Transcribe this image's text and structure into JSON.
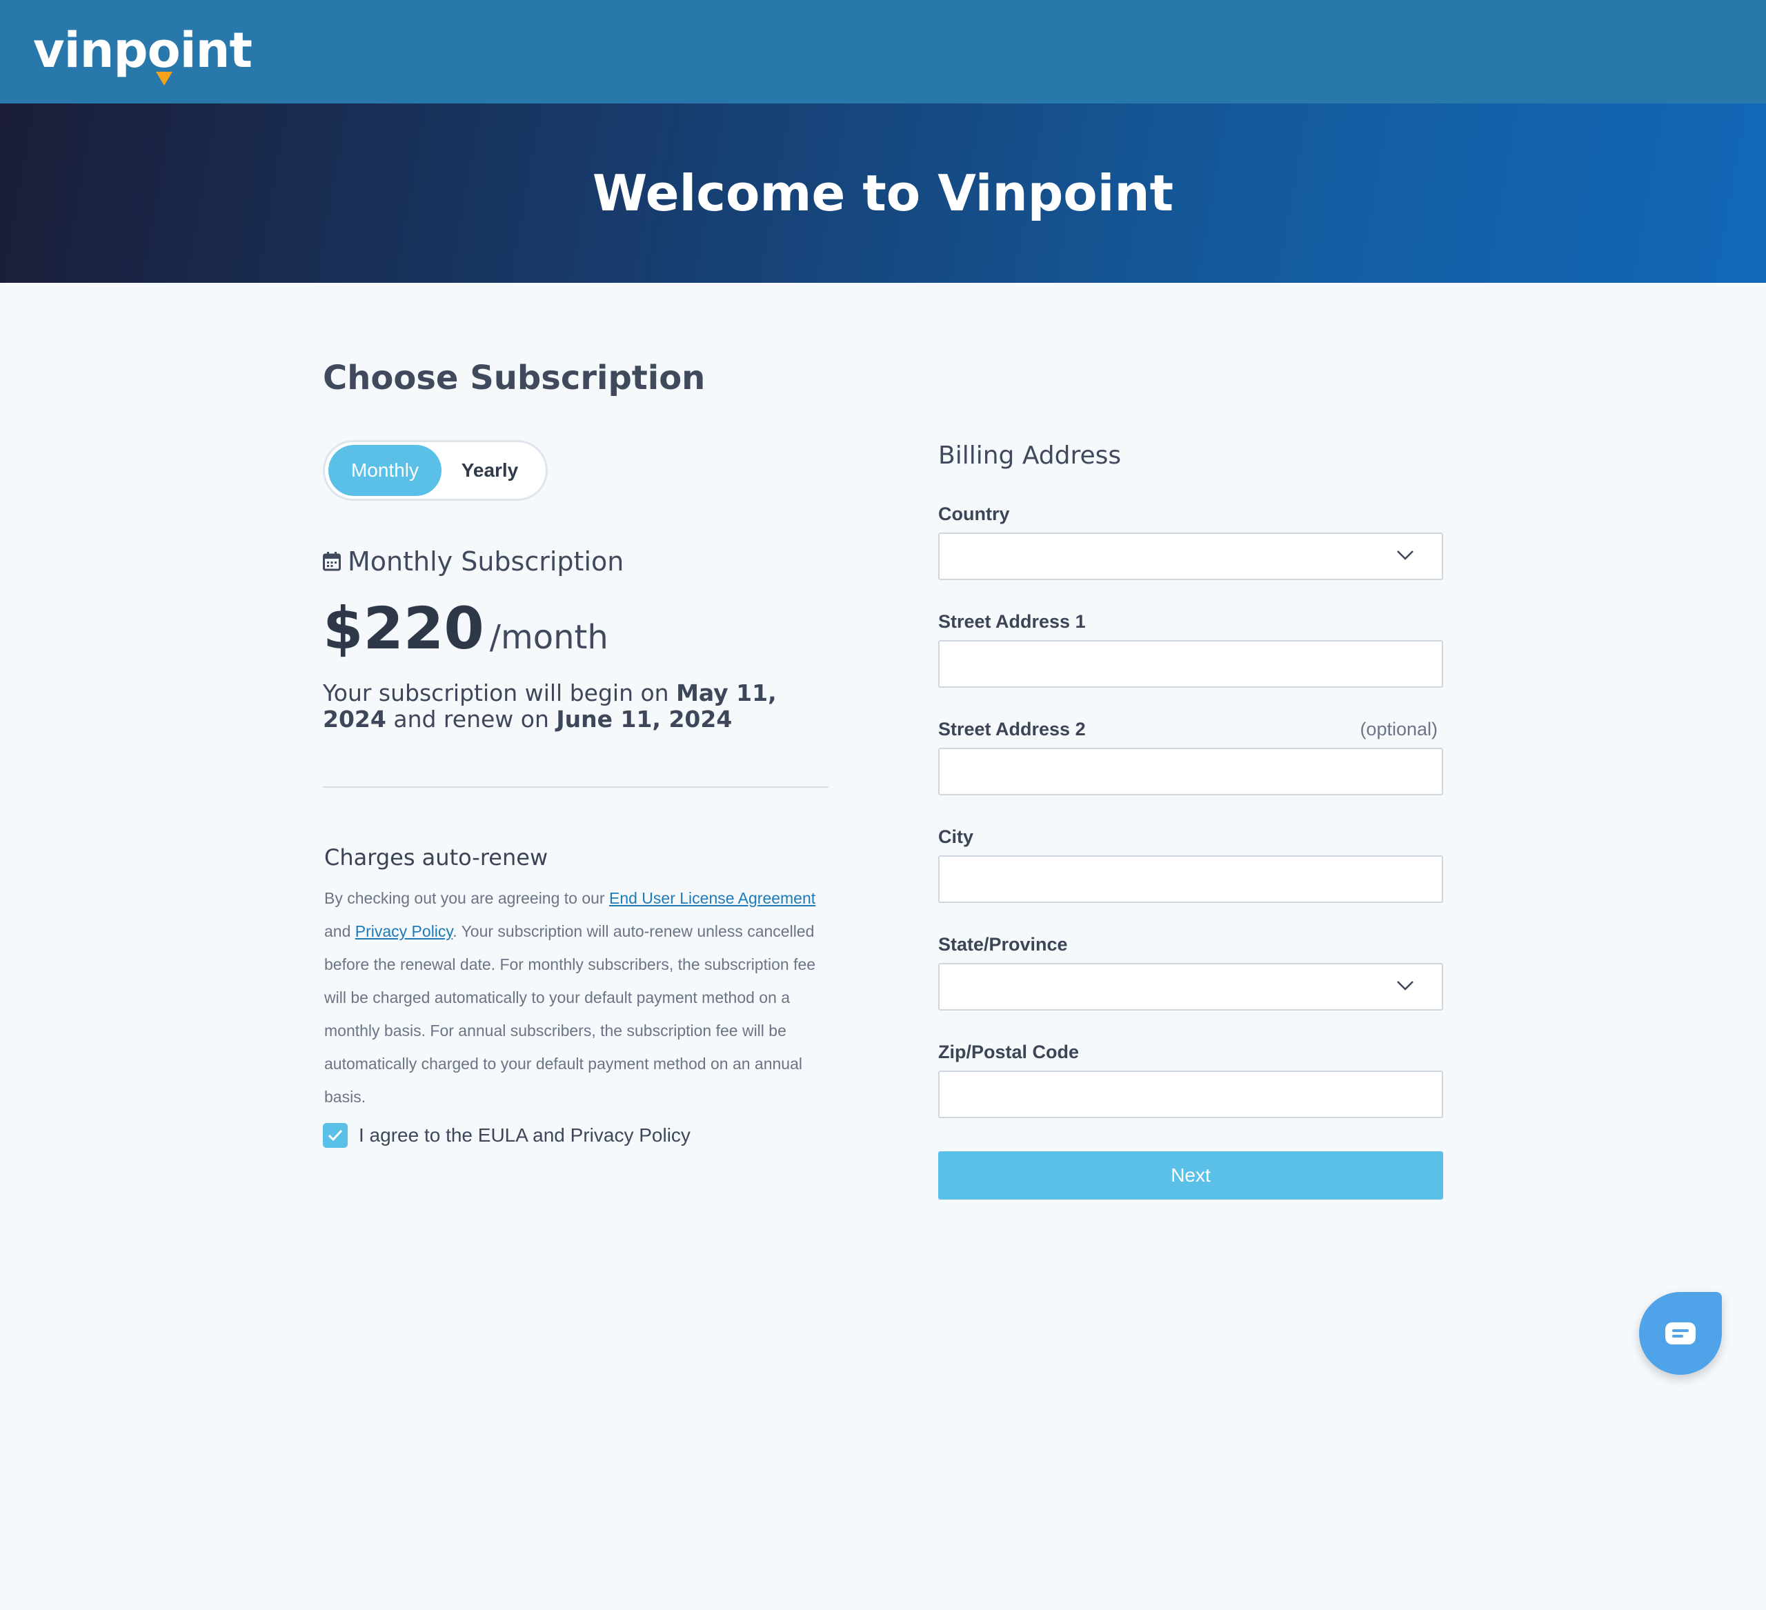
{
  "brand": {
    "logo_text_a": "vinp",
    "logo_text_b": "o",
    "logo_text_c": "int",
    "accent": "#f7a21b"
  },
  "hero": {
    "title": "Welcome to Vinpoint"
  },
  "subscription": {
    "title": "Choose Subscription",
    "toggle": {
      "monthly": "Monthly",
      "yearly": "Yearly",
      "selected": "Monthly"
    },
    "plan_title": "Monthly Subscription",
    "price": "$220",
    "period": "/month",
    "begin_text_1": "Your subscription will begin on ",
    "begin_date": "May 11, 2024",
    "begin_text_2": " and renew on ",
    "renew_date": "June 11, 2024"
  },
  "charges": {
    "title": "Charges auto-renew",
    "legal_1": "By checking out you are agreeing to our ",
    "eula_link": "End User License Agreement",
    "legal_2": " and ",
    "privacy_link": "Privacy Policy",
    "legal_3": ". Your subscription will auto-renew unless cancelled before the renewal date. For monthly subscribers, the subscription fee will be charged automatically to your default payment method on a monthly basis. For annual subscribers, the subscription fee will be automatically charged to your default payment method on an annual basis.",
    "agree_label": "I agree to the EULA and Privacy Policy",
    "agree_checked": true
  },
  "billing": {
    "title": "Billing Address",
    "fields": [
      {
        "label": "Country",
        "value": "",
        "type": "select"
      },
      {
        "label": "Street Address 1",
        "value": "",
        "type": "text"
      },
      {
        "label": "Street Address 2",
        "value": "",
        "type": "text",
        "hint": "(optional)"
      },
      {
        "label": "City",
        "value": "",
        "type": "text"
      },
      {
        "label": "State/Province",
        "value": "",
        "type": "select"
      },
      {
        "label": "Zip/Postal Code",
        "value": "",
        "type": "text"
      }
    ],
    "next_label": "Next"
  },
  "colors": {
    "primary": "#5bc0e8",
    "topbar": "#2878ab",
    "link": "#1f7ab8",
    "chat": "#4fa3e8"
  }
}
